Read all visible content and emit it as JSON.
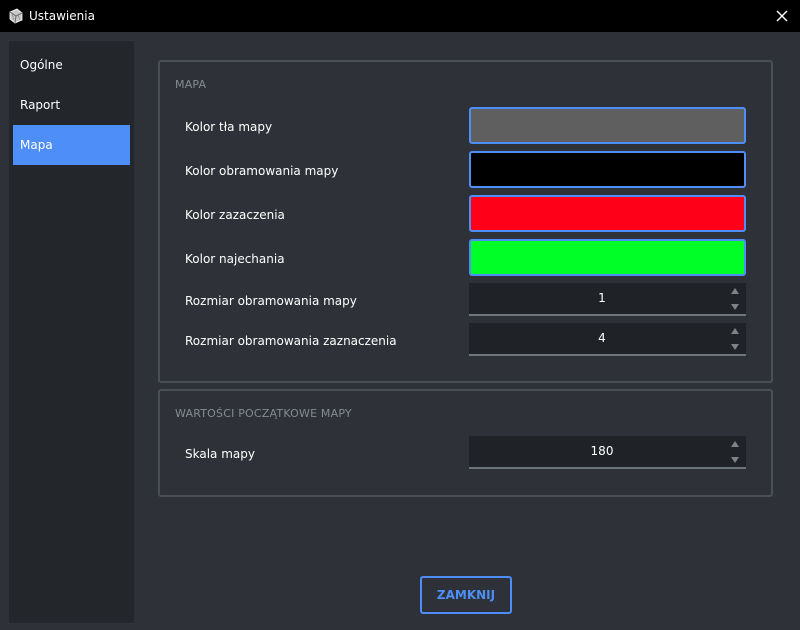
{
  "window": {
    "title": "Ustawienia",
    "app_icon": "settings-app-icon",
    "close_icon": "close-icon"
  },
  "sidebar": {
    "items": [
      {
        "label": "Ogólne",
        "active": false
      },
      {
        "label": "Raport",
        "active": false
      },
      {
        "label": "Mapa",
        "active": true
      }
    ]
  },
  "map_group": {
    "title": "MAPA",
    "rows": [
      {
        "label": "Kolor tła mapy",
        "type": "color",
        "color": "#5f5f5f"
      },
      {
        "label": "Kolor obramowania mapy",
        "type": "color",
        "color": "#000000"
      },
      {
        "label": "Kolor zazaczenia",
        "type": "color",
        "color": "#ff0019"
      },
      {
        "label": "Kolor najechania",
        "type": "color",
        "color": "#00ff26"
      },
      {
        "label": "Rozmiar obramowania mapy",
        "type": "spin",
        "value": "1"
      },
      {
        "label": "Rozmiar obramowania zaznaczenia",
        "type": "spin",
        "value": "4"
      }
    ]
  },
  "initial_group": {
    "title": "WARTOŚCI POCZĄTKOWE MAPY",
    "rows": [
      {
        "label": "Skala mapy",
        "type": "spin",
        "value": "180"
      }
    ]
  },
  "footer": {
    "close_label": "ZAMKNIJ"
  },
  "colors": {
    "accent": "#4d8ef8",
    "background": "#2e3238",
    "sidebar": "#23272c",
    "titlebar": "#000000"
  }
}
